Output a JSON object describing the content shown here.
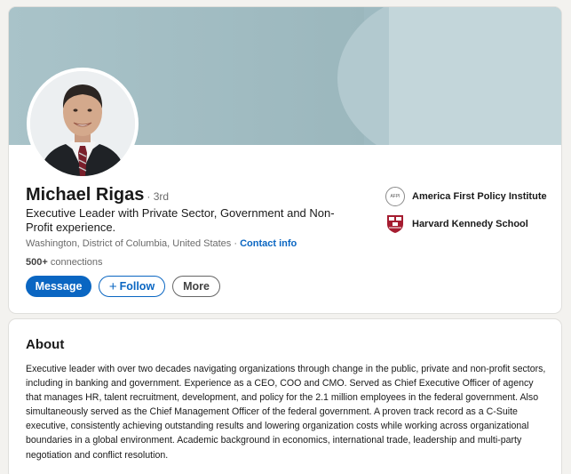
{
  "profile": {
    "name": "Michael Rigas",
    "degree": "· 3rd",
    "headline": "Executive Leader with Private Sector, Government and Non-Profit experience.",
    "location": "Washington, District of Columbia, United States",
    "location_separator": " · ",
    "contact_info": "Contact info",
    "connections_count": "500+",
    "connections_label": " connections"
  },
  "actions": {
    "message": "Message",
    "follow": "Follow",
    "more": "More"
  },
  "organizations": [
    {
      "name": "America First Policy Institute",
      "icon": "afpi-logo-icon",
      "logo_text": "AFPI"
    },
    {
      "name": "Harvard Kennedy School",
      "icon": "harvard-shield-icon"
    }
  ],
  "about": {
    "title": "About",
    "text": "Executive leader with over two decades navigating organizations through change in the public, private and non-profit sectors, including in banking and government. Experience as a CEO, COO and CMO. Served as Chief Executive Officer of agency that manages HR, talent recruitment, development, and policy for the 2.1 million employees in the federal government. Also simultaneously served as the Chief Management Officer of the federal government. A proven track record as a C-Suite executive, consistently achieving outstanding results and lowering organization costs while working across organizational boundaries in a global environment. Academic background in economics, international trade, leadership and multi-party negotiation and conflict resolution."
  },
  "colors": {
    "primary": "#0a66c2",
    "banner": "#9ebac1",
    "harvard_crimson": "#a51c30"
  }
}
